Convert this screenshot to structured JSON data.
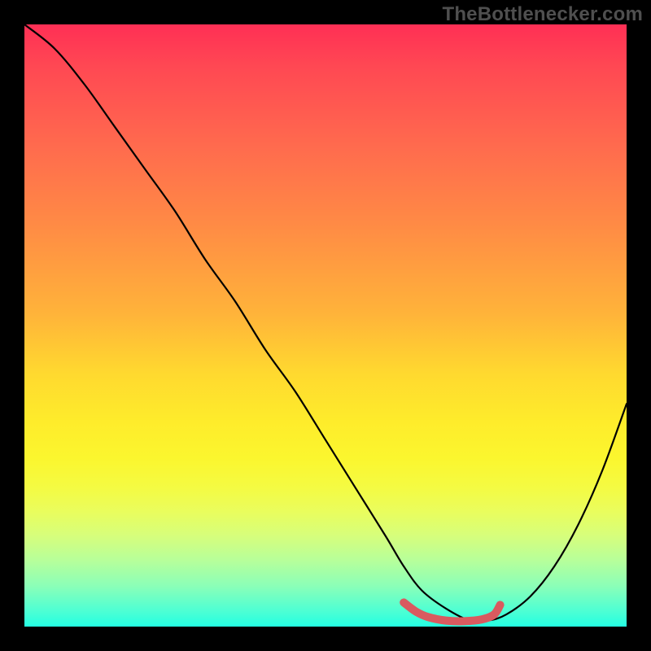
{
  "attribution": "TheBottlenecker.com",
  "chart_data": {
    "type": "line",
    "title": "",
    "xlabel": "",
    "ylabel": "",
    "xlim": [
      0,
      100
    ],
    "ylim": [
      0,
      100
    ],
    "series": [
      {
        "name": "bottleneck-curve",
        "x": [
          0,
          5,
          10,
          15,
          20,
          25,
          30,
          35,
          40,
          45,
          50,
          55,
          60,
          63,
          66,
          70,
          74,
          77,
          80,
          84,
          88,
          92,
          96,
          100
        ],
        "y": [
          100,
          96,
          90,
          83,
          76,
          69,
          61,
          54,
          46,
          39,
          31,
          23,
          15,
          10,
          6,
          3,
          1,
          1,
          2,
          5,
          10,
          17,
          26,
          37
        ]
      },
      {
        "name": "optimal-band",
        "x": [
          63,
          65,
          67,
          70,
          73,
          76,
          78,
          79
        ],
        "y": [
          4,
          2.5,
          1.6,
          1,
          0.9,
          1.2,
          2,
          3.6
        ]
      }
    ],
    "optimal_color": "#d95a5f",
    "curve_color": "#000000"
  }
}
